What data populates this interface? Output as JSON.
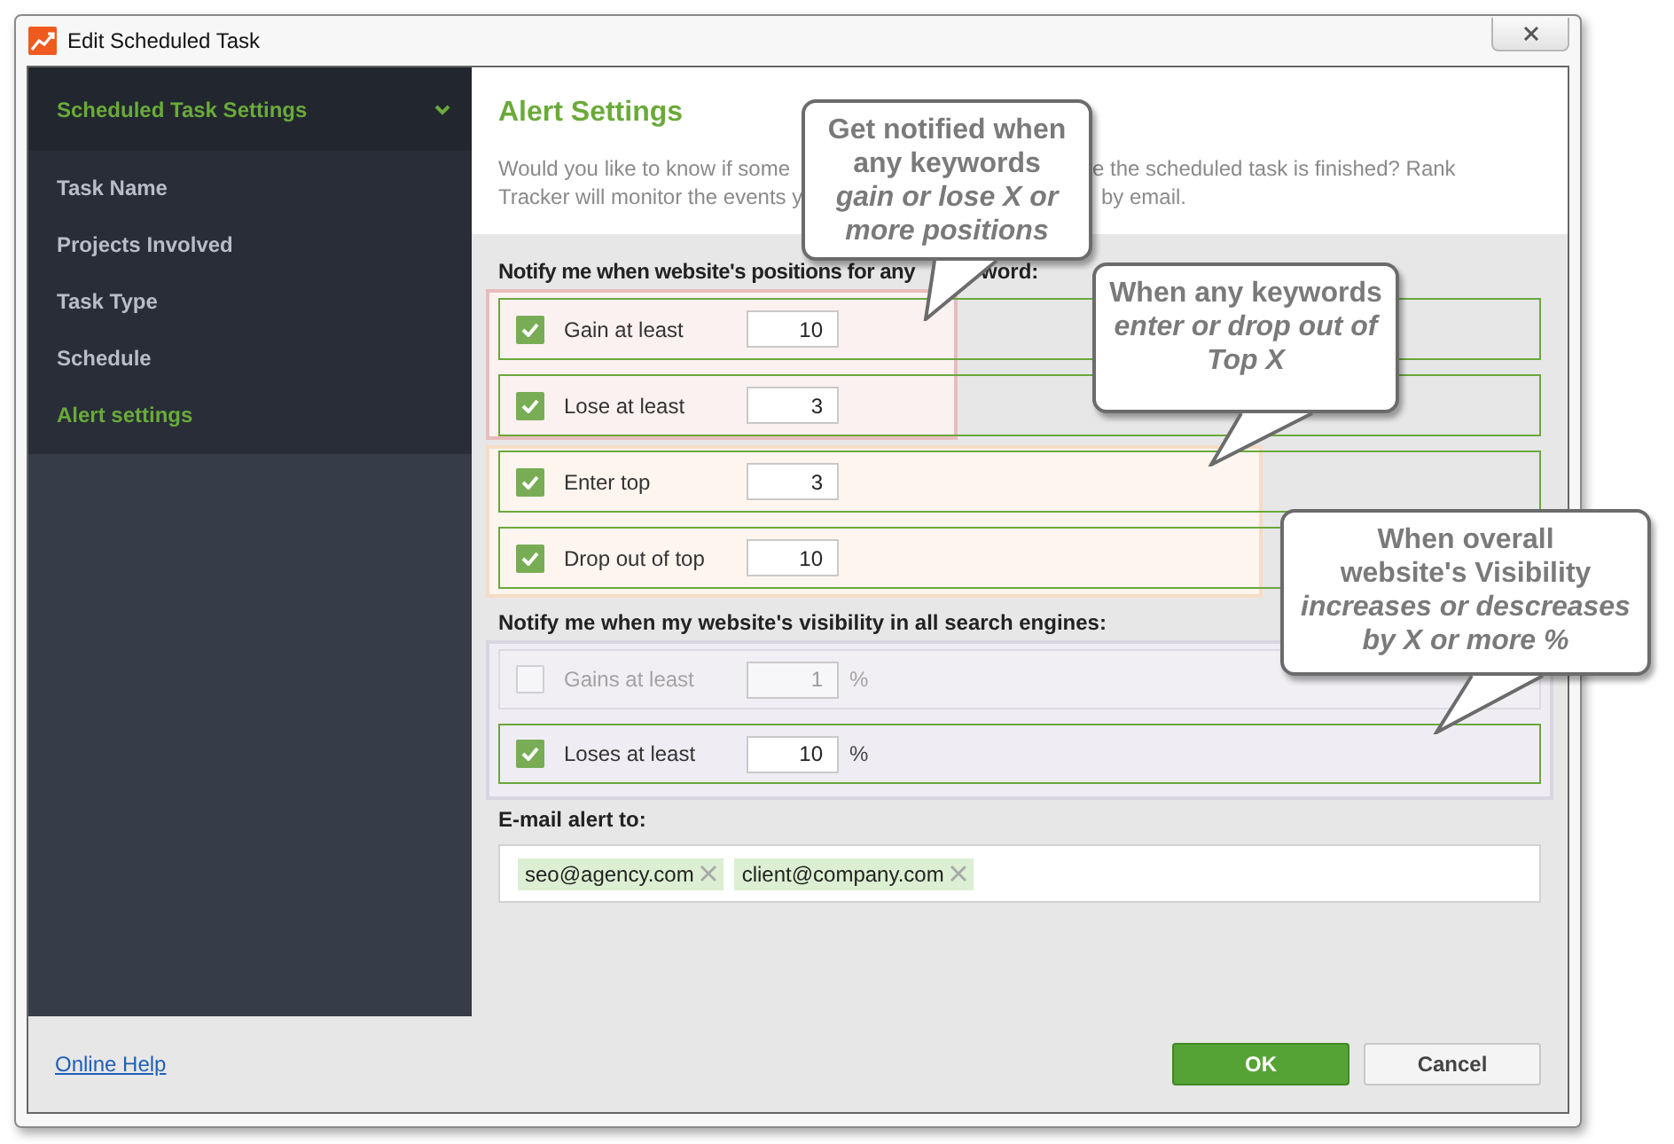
{
  "window": {
    "title": "Edit Scheduled Task"
  },
  "sidebar": {
    "header": "Scheduled Task Settings",
    "items": [
      {
        "label": "Task Name",
        "selected": false
      },
      {
        "label": "Projects Involved",
        "selected": false
      },
      {
        "label": "Task Type",
        "selected": false
      },
      {
        "label": "Schedule",
        "selected": false
      },
      {
        "label": "Alert settings",
        "selected": true
      }
    ]
  },
  "content": {
    "title": "Alert Settings",
    "intro_lines": [
      {
        "left": "Would you like to know if some",
        "right": "e the scheduled task is finished? Rank"
      },
      {
        "left": "Tracker will monitor the events y",
        "right": "by email."
      }
    ]
  },
  "positions": {
    "heading_left": "Notify me when website's positions for any",
    "heading_right": "word:",
    "rows": [
      {
        "label": "Gain at least",
        "checked": true,
        "disabled": false,
        "value": "10"
      },
      {
        "label": "Lose at least",
        "checked": true,
        "disabled": false,
        "value": "3"
      },
      {
        "label": "Enter top",
        "checked": true,
        "disabled": false,
        "value": "3"
      },
      {
        "label": "Drop out of top",
        "checked": true,
        "disabled": false,
        "value": "10"
      }
    ]
  },
  "visibility": {
    "heading": "Notify me when my website's visibility in all search engines:",
    "rows": [
      {
        "label": "Gains at least",
        "checked": false,
        "disabled": true,
        "value": "1",
        "unit": "%"
      },
      {
        "label": "Loses at least",
        "checked": true,
        "disabled": false,
        "value": "10",
        "unit": "%"
      }
    ]
  },
  "email": {
    "label": "E-mail alert to:",
    "recipients": [
      "seo@agency.com",
      "client@company.com"
    ]
  },
  "callouts": [
    {
      "text": "Get notified when\nany keywords\n*gain or lose X or*\n*more positions*"
    },
    {
      "text": "When any keywords\n*enter or drop out of*\n*Top X*"
    },
    {
      "text": "When overall\nwebsite's Visibility\n*increases or descreases*\n*by X or more %*"
    }
  ],
  "footer": {
    "help_link": "Online Help",
    "buttons": [
      {
        "label": "OK",
        "kind": "primary"
      },
      {
        "label": "Cancel",
        "kind": "secondary"
      }
    ]
  }
}
